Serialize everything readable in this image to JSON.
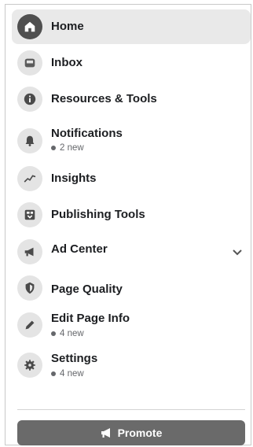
{
  "nav": {
    "home": "Home",
    "inbox": "Inbox",
    "resources": "Resources & Tools",
    "notifications": "Notifications",
    "notifications_sub": "2 new",
    "insights": "Insights",
    "publishing": "Publishing Tools",
    "adcenter": "Ad Center",
    "quality": "Page Quality",
    "editinfo": "Edit Page Info",
    "editinfo_sub": "4 new",
    "settings": "Settings",
    "settings_sub": "4 new"
  },
  "footer": {
    "promote_label": "Promote"
  },
  "icons": {
    "home": "home-icon",
    "inbox": "inbox-icon",
    "resources": "info-icon",
    "notifications": "bell-icon",
    "insights": "chart-line-icon",
    "publishing": "publishing-icon",
    "adcenter": "megaphone-icon",
    "quality": "shield-icon",
    "editinfo": "pencil-icon",
    "settings": "gear-icon",
    "chevron": "chevron-down-icon",
    "promote": "megaphone-icon"
  },
  "colors": {
    "active_bg": "#e9e9e9",
    "promote_bg": "#6a6a6a"
  }
}
